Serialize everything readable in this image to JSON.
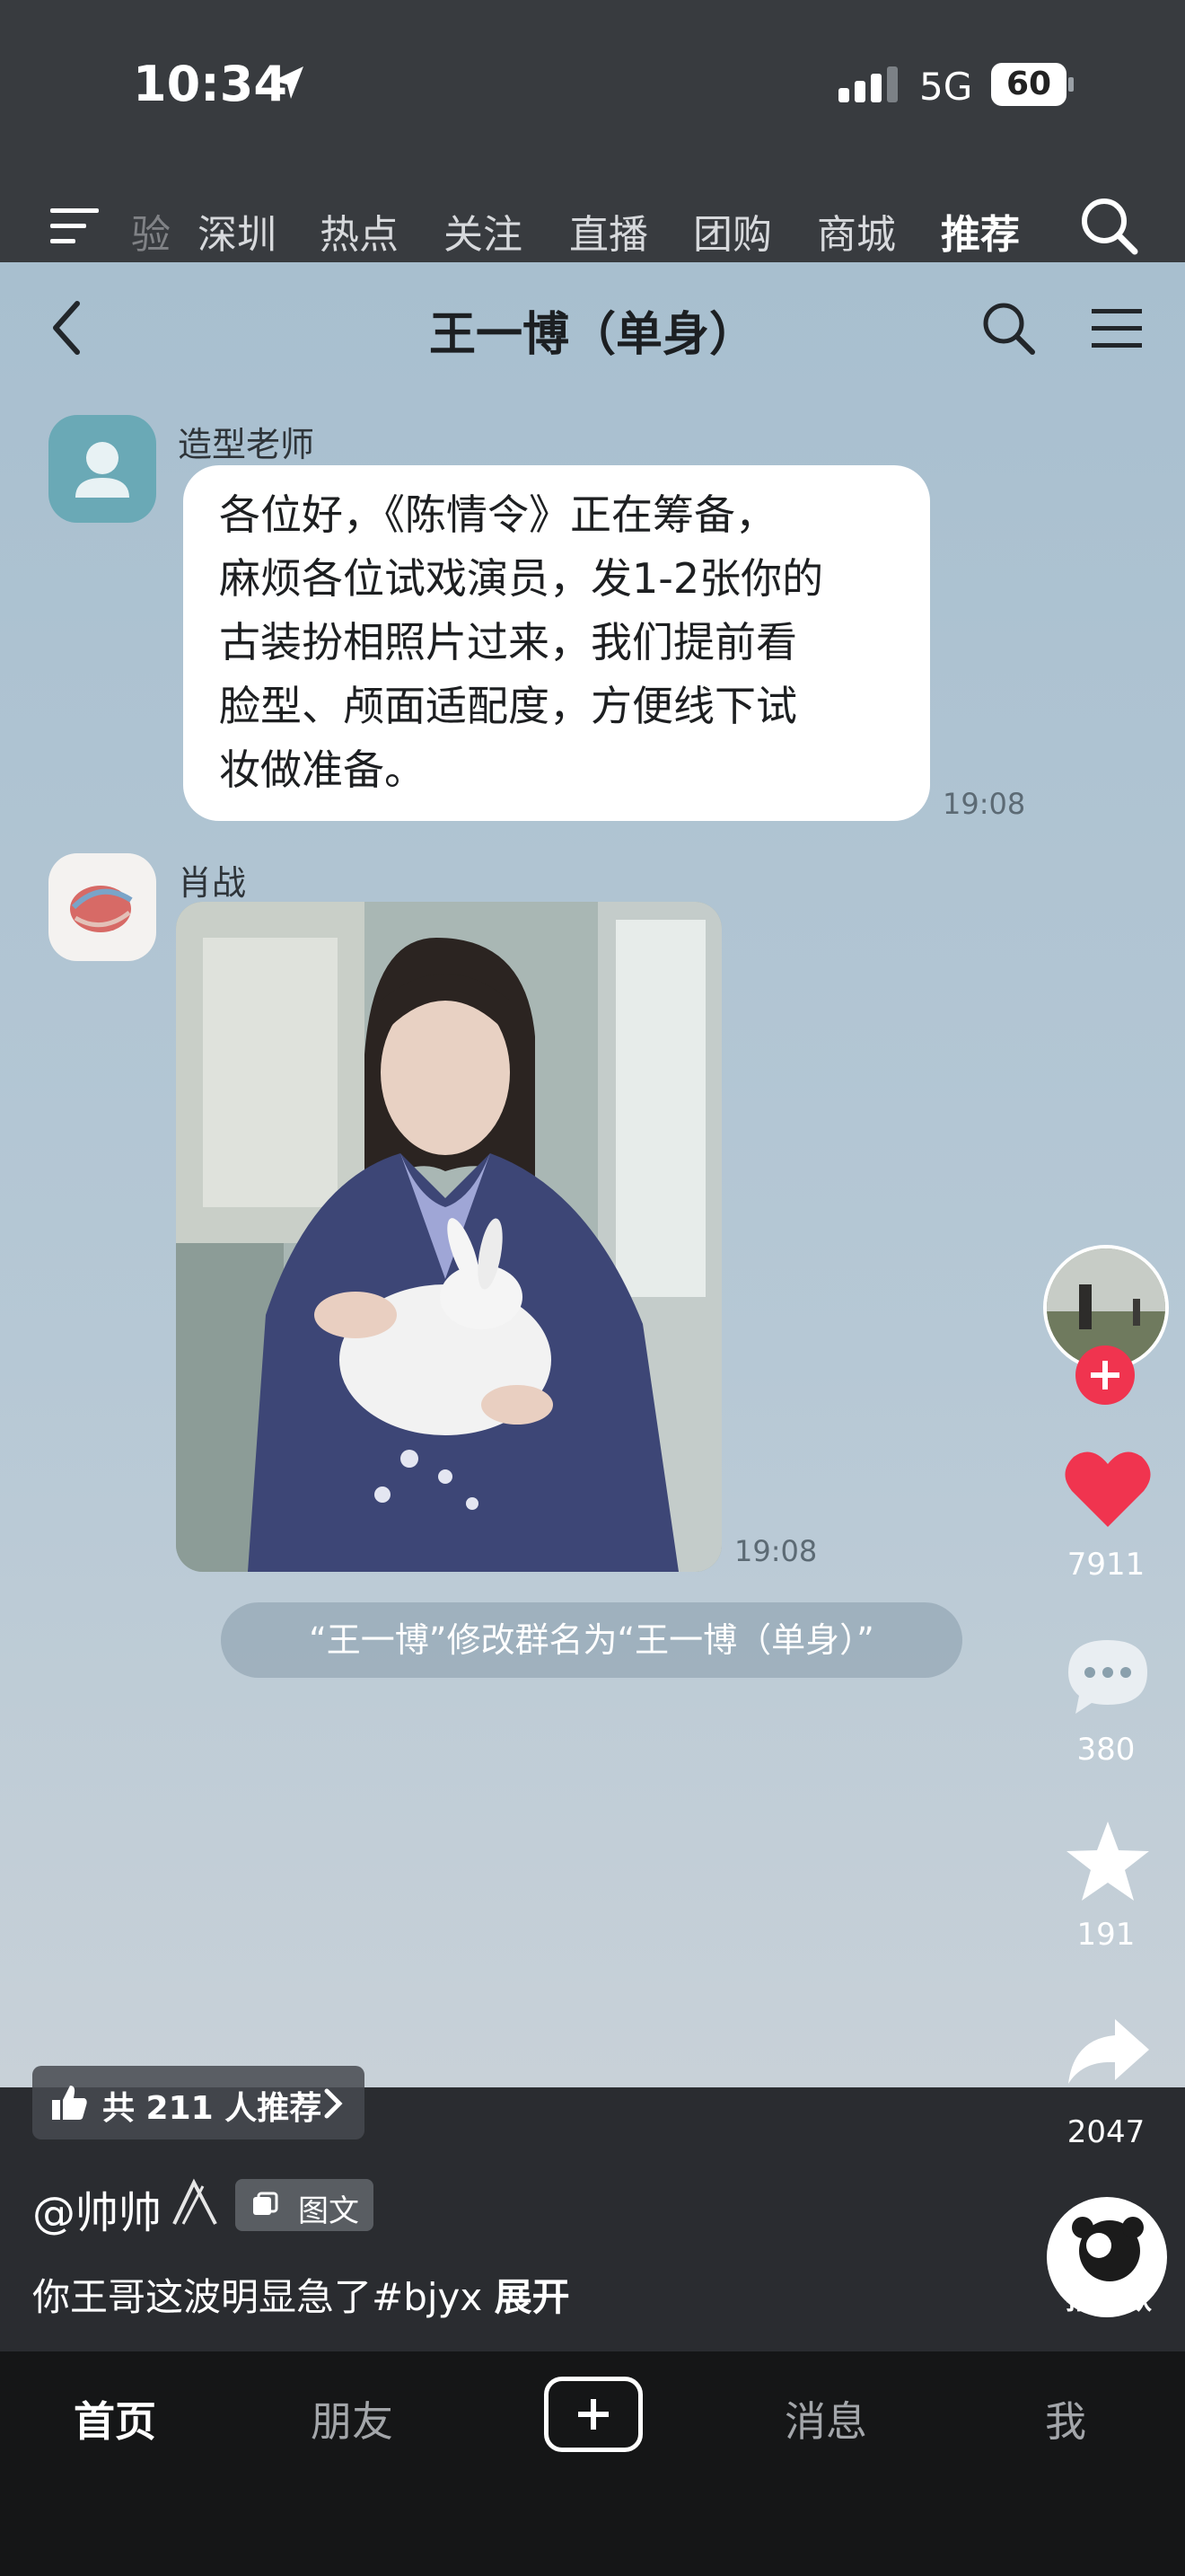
{
  "status_bar": {
    "time": "10:34",
    "network": "5G",
    "battery": "60"
  },
  "top_nav": {
    "tabs": [
      "验",
      "深圳",
      "热点",
      "关注",
      "直播",
      "团购",
      "商城",
      "推荐"
    ],
    "active": "推荐"
  },
  "chat": {
    "title": "王一博（单身）",
    "messages": [
      {
        "sender": "造型老师",
        "text": "各位好，《陈情令》正在筹备，麻烦各位试戏演员，发1-2张你的古装扮相照片过来，我们提前看脸型、颅面适配度，方便线下试妆做准备。",
        "lines": [
          "各位好，《陈情令》正在筹备，",
          "麻烦各位试戏演员，发1-2张你的",
          "古装扮相照片过来，我们提前看",
          "脸型、颅面适配度，方便线下试",
          "妆做准备。"
        ],
        "time": "19:08"
      },
      {
        "sender": "肖战",
        "type": "image",
        "time": "19:08"
      }
    ],
    "system_note": "“王一博”修改群名为“王一博（单身）”"
  },
  "right_rail": {
    "likes": "7911",
    "comments": "380",
    "favorites": "191",
    "shares": "2047",
    "same_style_label": "拍同款"
  },
  "video_info": {
    "recommend": "共 211 人推荐",
    "author": "@帅帅",
    "content_type": "图文",
    "caption": "你王哥这波明显急了#bjyx",
    "expand": "展开"
  },
  "bottom_bar": {
    "items": [
      "首页",
      "朋友",
      "消息",
      "我"
    ],
    "active": "首页"
  },
  "colors": {
    "accent_red": "#f0344f",
    "like_red": "#f0344f"
  }
}
